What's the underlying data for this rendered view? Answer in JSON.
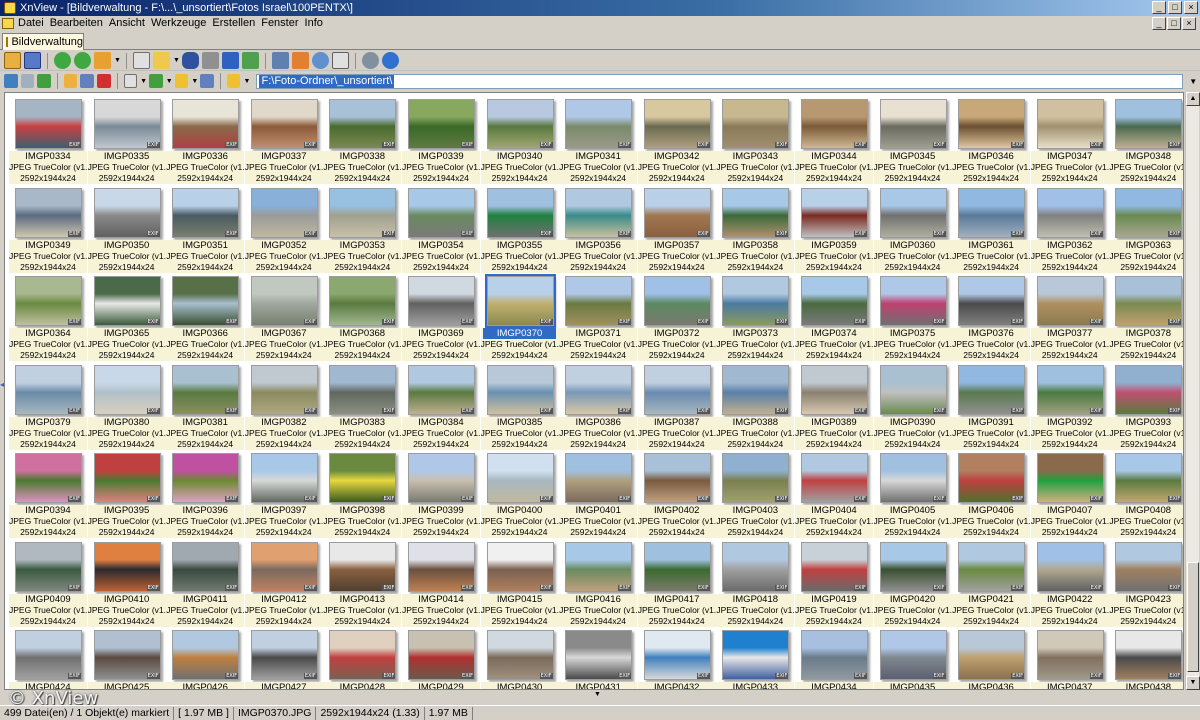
{
  "window": {
    "title": "XnView - [Bildverwaltung - F:\\...\\_unsortiert\\Fotos Israel\\100PENTX\\]"
  },
  "menu": [
    "Datei",
    "Bearbeiten",
    "Ansicht",
    "Werkzeuge",
    "Erstellen",
    "Fenster",
    "Info"
  ],
  "tab": {
    "label": "Bildverwaltung"
  },
  "path": {
    "value": "F:\\Foto-Ordner\\_unsortiert\\"
  },
  "thumbnail_meta": {
    "type": "JPEG TrueColor (v1.1)",
    "dims": "2592x1944x24",
    "badge": "EXIF"
  },
  "selected_file": "IMGP0370",
  "files": [
    {
      "name": "IMGP0334",
      "colors": [
        "#a6b5c4",
        "#c84040",
        "#3c6070"
      ]
    },
    {
      "name": "IMGP0335",
      "colors": [
        "#d8d8d8",
        "#7a8a96",
        "#c0c8d0"
      ]
    },
    {
      "name": "IMGP0336",
      "colors": [
        "#e8e4d8",
        "#8a6a4a",
        "#b04040"
      ]
    },
    {
      "name": "IMGP0337",
      "colors": [
        "#e0d8c8",
        "#8a5a3a",
        "#c09070"
      ]
    },
    {
      "name": "IMGP0338",
      "colors": [
        "#a8c0d8",
        "#4a6a30",
        "#7a8a50"
      ]
    },
    {
      "name": "IMGP0339",
      "colors": [
        "#88a860",
        "#3a6a28",
        "#607a40"
      ]
    },
    {
      "name": "IMGP0340",
      "colors": [
        "#b8c8e0",
        "#587840",
        "#a0a870"
      ]
    },
    {
      "name": "IMGP0341",
      "colors": [
        "#b0c8e8",
        "#7a8a6a",
        "#9a9a8a"
      ]
    },
    {
      "name": "IMGP0342",
      "colors": [
        "#d8c8a0",
        "#6a6a50",
        "#b0a080"
      ]
    },
    {
      "name": "IMGP0343",
      "colors": [
        "#c8b890",
        "#8a7a5a",
        "#a09070"
      ]
    },
    {
      "name": "IMGP0344",
      "colors": [
        "#b89870",
        "#7a5a3a",
        "#d0b890"
      ]
    },
    {
      "name": "IMGP0345",
      "colors": [
        "#e8e0d0",
        "#6a6a60",
        "#a0a090"
      ]
    },
    {
      "name": "IMGP0346",
      "colors": [
        "#c8a878",
        "#6a5030",
        "#e0c8a0"
      ]
    },
    {
      "name": "IMGP0347",
      "colors": [
        "#d0c0a0",
        "#a09070",
        "#e8e0c8"
      ]
    },
    {
      "name": "IMGP0348",
      "colors": [
        "#a0c0e0",
        "#4a6a50",
        "#c0b090"
      ]
    },
    {
      "name": "IMGP0349",
      "colors": [
        "#a8b8c8",
        "#5a6a80",
        "#d0c8b0"
      ]
    },
    {
      "name": "IMGP0350",
      "colors": [
        "#c8d8e8",
        "#8a8a8a",
        "#606060"
      ]
    },
    {
      "name": "IMGP0351",
      "colors": [
        "#b8d0e8",
        "#4a5a60",
        "#7a8070"
      ]
    },
    {
      "name": "IMGP0352",
      "colors": [
        "#88b0d8",
        "#9a9a9a",
        "#c0b8a0"
      ]
    },
    {
      "name": "IMGP0353",
      "colors": [
        "#98c0e0",
        "#a0a090",
        "#c8c0a8"
      ]
    },
    {
      "name": "IMGP0354",
      "colors": [
        "#a8c8e8",
        "#6a8a60",
        "#7a7a7a"
      ]
    },
    {
      "name": "IMGP0355",
      "colors": [
        "#a0c0e0",
        "#208040",
        "#707070"
      ]
    },
    {
      "name": "IMGP0356",
      "colors": [
        "#b0c8e0",
        "#3a8a8a",
        "#c8c0a0"
      ]
    },
    {
      "name": "IMGP0357",
      "colors": [
        "#b8d0e8",
        "#a07850",
        "#8a6040"
      ]
    },
    {
      "name": "IMGP0358",
      "colors": [
        "#a8c8e8",
        "#3a6a3a",
        "#b09070"
      ]
    },
    {
      "name": "IMGP0359",
      "colors": [
        "#b8d0e8",
        "#7a2a20",
        "#c0c0c0"
      ]
    },
    {
      "name": "IMGP0360",
      "colors": [
        "#a8c8e8",
        "#707070",
        "#b0b0a0"
      ]
    },
    {
      "name": "IMGP0361",
      "colors": [
        "#90b8e0",
        "#5a7a98",
        "#a0b0c0"
      ]
    },
    {
      "name": "IMGP0362",
      "colors": [
        "#a0c0e8",
        "#808080",
        "#c0c0b0"
      ]
    },
    {
      "name": "IMGP0363",
      "colors": [
        "#90b8e0",
        "#6a8a50",
        "#a8a890"
      ]
    },
    {
      "name": "IMGP0364",
      "colors": [
        "#a8b890",
        "#6a8a40",
        "#c0c0a0"
      ]
    },
    {
      "name": "IMGP0365",
      "colors": [
        "#4a6a4a",
        "#e8e8e8",
        "#3a5a3a"
      ]
    },
    {
      "name": "IMGP0366",
      "colors": [
        "#587048",
        "#a8c0d0",
        "#3a5030"
      ]
    },
    {
      "name": "IMGP0367",
      "colors": [
        "#c0c8c0",
        "#a0a8a0",
        "#788070"
      ]
    },
    {
      "name": "IMGP0368",
      "colors": [
        "#8aa870",
        "#5a7a40",
        "#a0b890"
      ]
    },
    {
      "name": "IMGP0369",
      "colors": [
        "#d0d8e0",
        "#606060",
        "#a0a0a0"
      ]
    },
    {
      "name": "IMGP0370",
      "colors": [
        "#b8d0e8",
        "#c0b070",
        "#8a8a50"
      ]
    },
    {
      "name": "IMGP0371",
      "colors": [
        "#b0c8e8",
        "#6a7a40",
        "#a09060"
      ]
    },
    {
      "name": "IMGP0372",
      "colors": [
        "#a0c0e8",
        "#5a8a60",
        "#7a7a70"
      ]
    },
    {
      "name": "IMGP0373",
      "colors": [
        "#b0c8e0",
        "#4a7aa0",
        "#8a9a60"
      ]
    },
    {
      "name": "IMGP0374",
      "colors": [
        "#a8c8e8",
        "#4a6a40",
        "#7a7a7a"
      ]
    },
    {
      "name": "IMGP0375",
      "colors": [
        "#b0c8e8",
        "#c04070",
        "#707070"
      ]
    },
    {
      "name": "IMGP0376",
      "colors": [
        "#b0c8e8",
        "#4a4a4a",
        "#808080"
      ]
    },
    {
      "name": "IMGP0377",
      "colors": [
        "#b8c8d8",
        "#b09060",
        "#8a7a50"
      ]
    },
    {
      "name": "IMGP0378",
      "colors": [
        "#a8c0d8",
        "#7a8a50",
        "#c0a070"
      ]
    },
    {
      "name": "IMGP0379",
      "colors": [
        "#c0d0e0",
        "#6a8aa8",
        "#a8b8c0"
      ]
    },
    {
      "name": "IMGP0380",
      "colors": [
        "#c8d8e8",
        "#b0c0c8",
        "#d8d0c0"
      ]
    },
    {
      "name": "IMGP0381",
      "colors": [
        "#a8c0d0",
        "#5a7a40",
        "#8a9060"
      ]
    },
    {
      "name": "IMGP0382",
      "colors": [
        "#c0c8d0",
        "#8a8a60",
        "#b0a880"
      ]
    },
    {
      "name": "IMGP0383",
      "colors": [
        "#a0b8d0",
        "#606860",
        "#8a9080"
      ]
    },
    {
      "name": "IMGP0384",
      "colors": [
        "#b0c8e0",
        "#5a7a40",
        "#c0b090"
      ]
    },
    {
      "name": "IMGP0385",
      "colors": [
        "#b8c8d8",
        "#6a90b0",
        "#d0c0a0"
      ]
    },
    {
      "name": "IMGP0386",
      "colors": [
        "#c0d0e0",
        "#7a98b8",
        "#d8c8a8"
      ]
    },
    {
      "name": "IMGP0387",
      "colors": [
        "#c0d0e0",
        "#6a8ab0",
        "#a8b8c0"
      ]
    },
    {
      "name": "IMGP0388",
      "colors": [
        "#a0b8d0",
        "#5a80a8",
        "#c0b090"
      ]
    },
    {
      "name": "IMGP0389",
      "colors": [
        "#c0c8d0",
        "#8a8070",
        "#d8c8b0"
      ]
    },
    {
      "name": "IMGP0390",
      "colors": [
        "#a8c0d0",
        "#c0c0c0",
        "#6a8a50"
      ]
    },
    {
      "name": "IMGP0391",
      "colors": [
        "#90b8e0",
        "#5a7a50",
        "#909090"
      ]
    },
    {
      "name": "IMGP0392",
      "colors": [
        "#a0c0e0",
        "#4a7a40",
        "#a0a080"
      ]
    },
    {
      "name": "IMGP0393",
      "colors": [
        "#90b0d0",
        "#c05070",
        "#5a7a40"
      ]
    },
    {
      "name": "IMGP0394",
      "colors": [
        "#d070a0",
        "#4a7a30",
        "#e090c0"
      ]
    },
    {
      "name": "IMGP0395",
      "colors": [
        "#c04040",
        "#4a7a30",
        "#e08080"
      ]
    },
    {
      "name": "IMGP0396",
      "colors": [
        "#c050a0",
        "#6a8a30",
        "#e0a0c0"
      ]
    },
    {
      "name": "IMGP0397",
      "colors": [
        "#a8c8e8",
        "#d8d8d8",
        "#606860"
      ]
    },
    {
      "name": "IMGP0398",
      "colors": [
        "#6a8a40",
        "#e8d840",
        "#3a5a20"
      ]
    },
    {
      "name": "IMGP0399",
      "colors": [
        "#b0c8e8",
        "#c8c0b0",
        "#7a7a70"
      ]
    },
    {
      "name": "IMGP0400",
      "colors": [
        "#d0e0f0",
        "#a8b8c0",
        "#c0b8a0"
      ]
    },
    {
      "name": "IMGP0401",
      "colors": [
        "#a0c0e0",
        "#b0a080",
        "#7a6a5a"
      ]
    },
    {
      "name": "IMGP0402",
      "colors": [
        "#a8c0d8",
        "#7a5a40",
        "#c0a080"
      ]
    },
    {
      "name": "IMGP0403",
      "colors": [
        "#90b0d0",
        "#7a8050",
        "#a0a070"
      ]
    },
    {
      "name": "IMGP0404",
      "colors": [
        "#b0c8e0",
        "#c04040",
        "#a0a0a0"
      ]
    },
    {
      "name": "IMGP0405",
      "colors": [
        "#a0c0e0",
        "#d8d8d8",
        "#707070"
      ]
    },
    {
      "name": "IMGP0406",
      "colors": [
        "#b08060",
        "#c04040",
        "#507030"
      ]
    },
    {
      "name": "IMGP0407",
      "colors": [
        "#8a6a4a",
        "#20a040",
        "#d0b080"
      ]
    },
    {
      "name": "IMGP0408",
      "colors": [
        "#a8c8e8",
        "#5a7a40",
        "#c0a870"
      ]
    },
    {
      "name": "IMGP0409",
      "colors": [
        "#b0b8c0",
        "#3a5a40",
        "#808880"
      ]
    },
    {
      "name": "IMGP0410",
      "colors": [
        "#e08040",
        "#2a2a30",
        "#c06030"
      ]
    },
    {
      "name": "IMGP0411",
      "colors": [
        "#a0a8b0",
        "#3a4a40",
        "#707a70"
      ]
    },
    {
      "name": "IMGP0412",
      "colors": [
        "#e0a070",
        "#7a6a60",
        "#c08060"
      ]
    },
    {
      "name": "IMGP0413",
      "colors": [
        "#e8e8e8",
        "#8a6040",
        "#504030"
      ]
    },
    {
      "name": "IMGP0414",
      "colors": [
        "#e0e0e8",
        "#6a5040",
        "#c08050"
      ]
    },
    {
      "name": "IMGP0415",
      "colors": [
        "#f0f0f0",
        "#7a6050",
        "#b08060"
      ]
    },
    {
      "name": "IMGP0416",
      "colors": [
        "#a8c8e8",
        "#6a8a60",
        "#c0a080"
      ]
    },
    {
      "name": "IMGP0417",
      "colors": [
        "#a0c0e0",
        "#3a6a30",
        "#7a7a6a"
      ]
    },
    {
      "name": "IMGP0418",
      "colors": [
        "#b0c8e0",
        "#a0a0a0",
        "#6a6a6a"
      ]
    },
    {
      "name": "IMGP0419",
      "colors": [
        "#c8d0d8",
        "#c04040",
        "#6a6a6a"
      ]
    },
    {
      "name": "IMGP0420",
      "colors": [
        "#a8c8e8",
        "#3a5030",
        "#909090"
      ]
    },
    {
      "name": "IMGP0421",
      "colors": [
        "#b0c8e0",
        "#6a8a40",
        "#a0a0a0"
      ]
    },
    {
      "name": "IMGP0422",
      "colors": [
        "#a0c0e8",
        "#b0a890",
        "#606060"
      ]
    },
    {
      "name": "IMGP0423",
      "colors": [
        "#b0c8e0",
        "#a08060",
        "#707070"
      ]
    },
    {
      "name": "IMGP0424",
      "colors": [
        "#c0d0e0",
        "#707070",
        "#a0a0a0"
      ]
    },
    {
      "name": "IMGP0425",
      "colors": [
        "#b0c0d0",
        "#5a4a40",
        "#909090"
      ]
    },
    {
      "name": "IMGP0426",
      "colors": [
        "#b0c8e0",
        "#c08040",
        "#707070"
      ]
    },
    {
      "name": "IMGP0427",
      "colors": [
        "#c0d0e0",
        "#4a4a4a",
        "#a0a0a0"
      ]
    },
    {
      "name": "IMGP0428",
      "colors": [
        "#e0d0c0",
        "#c04040",
        "#7a6050"
      ]
    },
    {
      "name": "IMGP0429",
      "colors": [
        "#c8c0b0",
        "#b03030",
        "#6a5a4a"
      ]
    },
    {
      "name": "IMGP0430",
      "colors": [
        "#d0d8e0",
        "#7a6a5a",
        "#a09080"
      ]
    },
    {
      "name": "IMGP0431",
      "colors": [
        "#8a8a8a",
        "#d8d8d8",
        "#4a4a4a"
      ]
    },
    {
      "name": "IMGP0432",
      "colors": [
        "#e0e8f0",
        "#4080c0",
        "#d8d8d8"
      ]
    },
    {
      "name": "IMGP0433",
      "colors": [
        "#2080d0",
        "#e8e8e8",
        "#4060a0"
      ]
    },
    {
      "name": "IMGP0434",
      "colors": [
        "#a8c0e0",
        "#6a7a8a",
        "#909aa0"
      ]
    },
    {
      "name": "IMGP0435",
      "colors": [
        "#b0c8e8",
        "#808890",
        "#5a6070"
      ]
    },
    {
      "name": "IMGP0436",
      "colors": [
        "#b8c8d8",
        "#c0a070",
        "#8a7050"
      ]
    },
    {
      "name": "IMGP0437",
      "colors": [
        "#d0c8b8",
        "#807060",
        "#a09888"
      ]
    },
    {
      "name": "IMGP0438",
      "colors": [
        "#e8e8e8",
        "#4a4a4a",
        "#a08060"
      ]
    }
  ],
  "status": {
    "files": "499 Datei(en) / 1 Objekt(e) markiert",
    "size": "[ 1.97 MB ]",
    "filename": "IMGP0370.JPG",
    "dimensions": "2592x1944x24 (1.33)",
    "filesize": "1.97 MB"
  },
  "watermark": "© XnView"
}
